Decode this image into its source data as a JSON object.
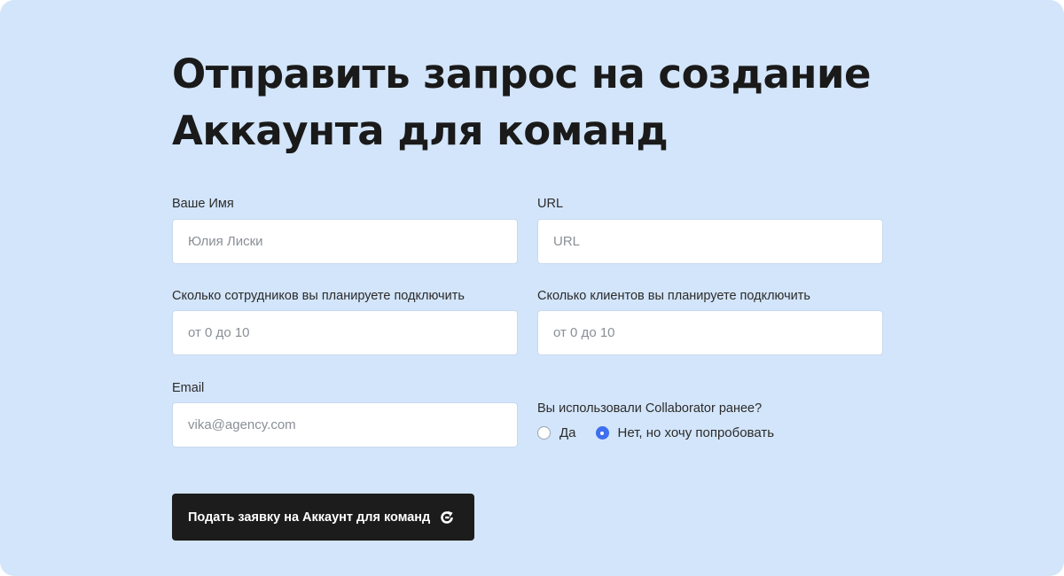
{
  "page": {
    "title_line1": "Отправить запрос на создание",
    "title_line2": "Аккаунта для команд"
  },
  "form": {
    "name": {
      "label": "Ваше Имя",
      "placeholder": "Юлия Лиски"
    },
    "url": {
      "label": "URL",
      "placeholder": "URL"
    },
    "employees": {
      "label": "Сколько сотрудников вы планируете подключить",
      "placeholder": "от 0 до 10"
    },
    "clients": {
      "label": "Сколько клиентов вы планируете подключить",
      "placeholder": "от 0 до 10"
    },
    "email": {
      "label": "Email",
      "placeholder": "vika@agency.com"
    },
    "used_before": {
      "question": "Вы использовали Collaborator ранее?",
      "options": [
        {
          "label": "Да",
          "checked": false
        },
        {
          "label": "Нет, но хочу попробовать",
          "checked": true
        }
      ]
    },
    "submit": {
      "label": "Подать заявку на Аккаунт для команд",
      "icon": "refresh-arrow-icon"
    }
  },
  "colors": {
    "background": "#d3e5fa",
    "button": "#1c1c1c",
    "radio_accent": "#3d6ff0"
  }
}
